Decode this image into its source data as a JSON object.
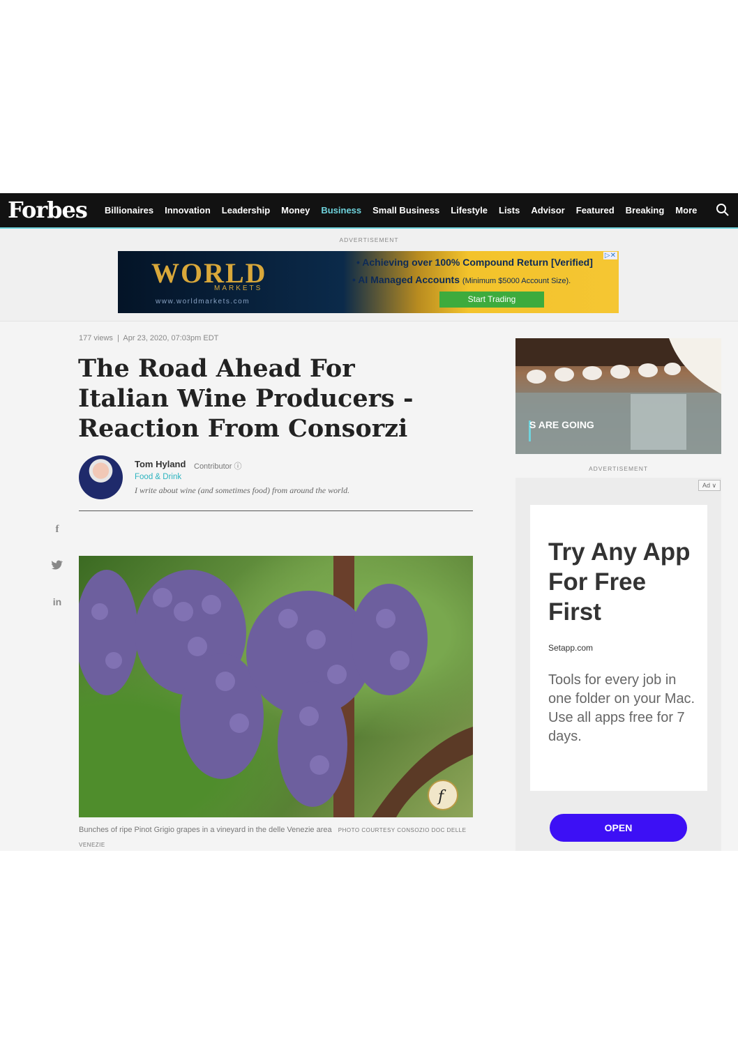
{
  "nav": {
    "logo": "Forbes",
    "links": [
      "Billionaires",
      "Innovation",
      "Leadership",
      "Money",
      "Business",
      "Small Business",
      "Lifestyle",
      "Lists",
      "Advisor",
      "Featured",
      "Breaking",
      "More"
    ],
    "active": "Business",
    "search_icon": "search-icon"
  },
  "top_ad": {
    "label": "ADVERTISEMENT",
    "brand": "WORLD",
    "brand_sub": "MARKETS",
    "url": "www.worldmarkets.com",
    "bullet1": "Achieving over 100% Compound Return [Verified]",
    "bullet2_bold": "AI Managed Accounts",
    "bullet2_small": "(Minimum $5000 Account Size).",
    "cta": "Start Trading"
  },
  "article": {
    "views": "177 views",
    "date": "Apr 23, 2020, 07:03pm EDT",
    "headline": "The Road Ahead For Italian Wine Producers - Reaction From Consorzi",
    "author": {
      "name": "Tom Hyland",
      "role": "Contributor",
      "section": "Food & Drink",
      "bio": "I write about wine (and sometimes food) from around the world."
    },
    "social": [
      "f",
      "✓",
      "in"
    ],
    "caption": "Bunches of ripe Pinot Grigio grapes in a vineyard in the delle Venezie area",
    "caption_credit": "PHOTO COURTESY CONSOZIO DOC DELLE VENEZIE"
  },
  "sidebar": {
    "video_text": "S ARE GOING",
    "ad_label": "ADVERTISEMENT",
    "ad_chip": "Ad ∨",
    "ad_title": "Try Any App For Free First",
    "ad_domain": "Setapp.com",
    "ad_body": "Tools for every job in one folder on your Mac. Use all apps free for 7 days.",
    "ad_cta": "OPEN"
  },
  "colors": {
    "nav_bg": "#121212",
    "accent": "#6fd3dc",
    "cta_purple": "#3d10f5",
    "ad_green": "#3dab3d"
  }
}
